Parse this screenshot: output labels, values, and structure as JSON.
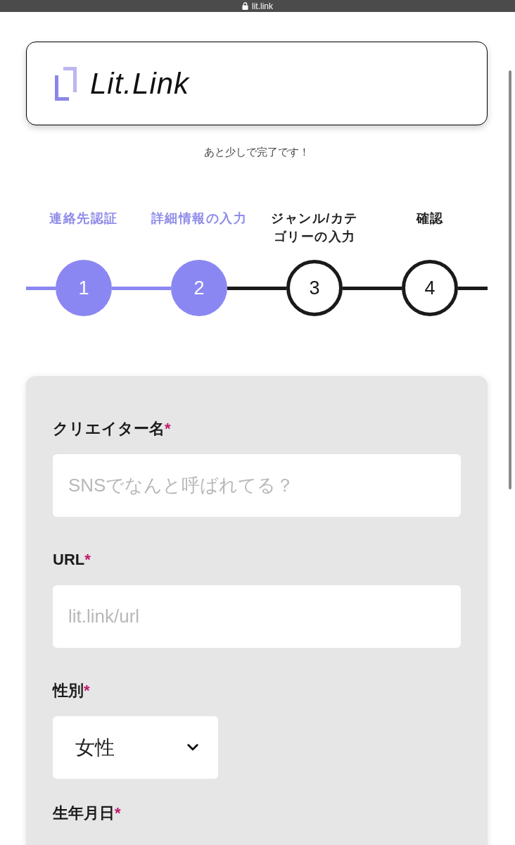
{
  "browser_bar": {
    "address": "lit.link"
  },
  "header": {
    "logo_text": "Lit.Link"
  },
  "subtitle": "あと少しで完了です！",
  "steps": [
    {
      "label": "連絡先認証",
      "number": "1",
      "done": true
    },
    {
      "label": "詳細情報の入力",
      "number": "2",
      "done": true
    },
    {
      "label": "ジャンル/カテゴリーの入力",
      "number": "3",
      "done": false
    },
    {
      "label": "確認",
      "number": "4",
      "done": false
    }
  ],
  "form": {
    "required_mark": "*",
    "fields": [
      {
        "kind": "text",
        "label": "クリエイター名",
        "required": true,
        "placeholder": "SNSでなんと呼ばれてる？"
      },
      {
        "kind": "text",
        "label": "URL",
        "required": true,
        "placeholder": "lit.link/url"
      },
      {
        "kind": "select",
        "label": "性別",
        "required": true,
        "value": "女性"
      },
      {
        "kind": "heading",
        "label": "生年月日",
        "required": true
      }
    ]
  }
}
